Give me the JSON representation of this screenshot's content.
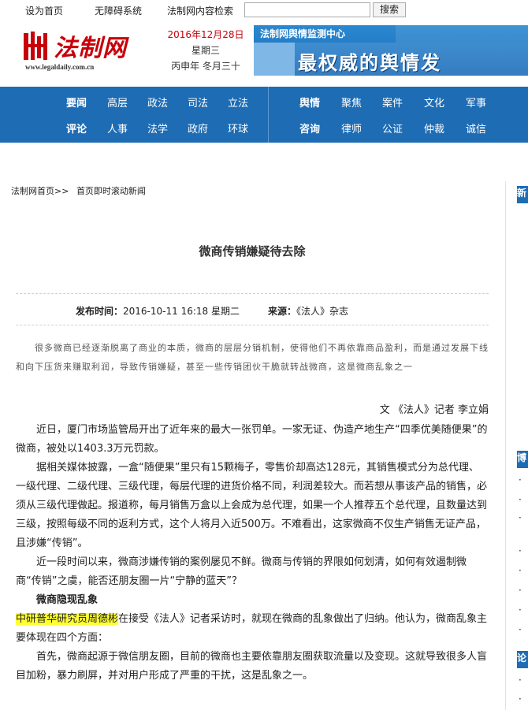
{
  "topbar": {
    "home": "设为首页",
    "accessible": "无障碍系统",
    "search_label": "法制网内容检索",
    "search_value": "",
    "search_button": "搜索"
  },
  "header": {
    "logo_text": "法制网",
    "logo_url": "www.legaldaily.com.cn",
    "date": "2016年12月28日",
    "weekday": "星期三",
    "lunar": "丙申年 冬月三十",
    "banner_top": "法制网舆情监测中心",
    "banner_main": "最权威的舆情发"
  },
  "nav": {
    "row1_left": [
      "要闻",
      "高层",
      "政法",
      "司法",
      "立法"
    ],
    "row1_right": [
      "舆情",
      "聚焦",
      "案件",
      "文化",
      "军事"
    ],
    "row2_left": [
      "评论",
      "人事",
      "法学",
      "政府",
      "环球"
    ],
    "row2_right": [
      "咨询",
      "律师",
      "公证",
      "仲裁",
      "诚信"
    ]
  },
  "breadcrumb": {
    "home": "法制网首页>>",
    "current": "首页即时滚动新闻"
  },
  "sidebar": {
    "tab1": "新",
    "tab2": "博",
    "tab3": "论",
    "items": [
      "·",
      "·",
      "·",
      "·",
      "·",
      "·",
      "·",
      "·",
      "·",
      "·",
      "·",
      "·",
      "·"
    ]
  },
  "article": {
    "title": "微商传销嫌疑待去除",
    "publish_label": "发布时间：",
    "publish_time": "2016-10-11 16:18 星期二",
    "source_label": "来源：",
    "source": "《法人》杂志",
    "summary": "很多微商已经逐渐脱离了商业的本质，微商的层层分销机制，使得他们不再依靠商品盈利，而是通过发展下线和向下压货来赚取利润，导致传销嫌疑，甚至一些传销团伙干脆就转战微商，这是微商乱象之一",
    "byline": "文 《法人》记者  李立娟",
    "p1": "近日，厦门市场监管局开出了近年来的最大一张罚单。一家无证、伪造产地生产“四季优美随便果”的微商，被处以1403.3万元罚款。",
    "p2": "据相关媒体披露，一盒“随便果”里只有15颗梅子，零售价却高达128元，其销售模式分为总代理、一级代理、二级代理、三级代理，每层代理的进货价格不同，利润差较大。而若想从事该产品的销售，必须从三级代理做起。报道称，每月销售万盒以上会成为总代理，如果一个人推荐五个总代理，且数量达到三级，按照每级不同的返利方式，这个人将月入近500万。不难看出，这家微商不仅生产销售无证产品，且涉嫌“传销”。",
    "p3": "近一段时间以来，微商涉嫌传销的案例屡见不鲜。微商与传销的界限如何划清，如何有效遏制微商“传销”之虞，能否还朋友圈一片“宁静的蓝天”？",
    "subhead": "微商隐现乱象",
    "p4_highlight": "中研普华研究员周德彬",
    "p4_rest": "在接受《法人》记者采访时，就现在微商的乱象做出了归纳。他认为，微商乱象主要体现在四个方面：",
    "p5": "首先，微商起源于微信朋友圈，目前的微商也主要依靠朋友圈获取流量以及变现。这就导致很多人盲目加粉，暴力刷屏，并对用户形成了严重的干扰，这是乱象之一。"
  },
  "colors": {
    "brand_red": "#c8000a",
    "nav_blue": "#1e6cb4",
    "highlight": "#ffff33"
  }
}
